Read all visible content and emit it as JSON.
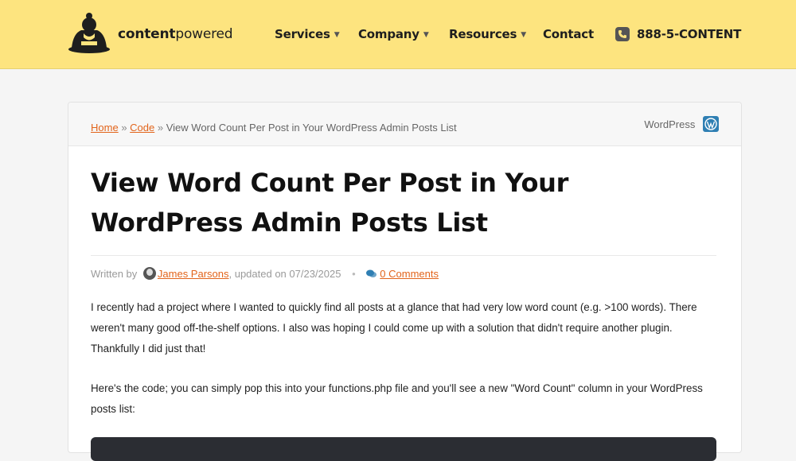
{
  "header": {
    "brand_bold": "content",
    "brand_light": "powered",
    "nav": {
      "services": "Services",
      "company": "Company",
      "resources": "Resources",
      "contact": "Contact"
    },
    "phone": "888-5-CONTENT"
  },
  "breadcrumb": {
    "home": "Home",
    "sep": "»",
    "code": "Code",
    "current": "View Word Count Per Post in Your WordPress Admin Posts List"
  },
  "category": "WordPress",
  "article": {
    "title": "View Word Count Per Post in Your WordPress Admin Posts List",
    "meta": {
      "written_by": "Written by",
      "author": "James Parsons",
      "updated": ", updated on 07/23/2025",
      "comments": "0 Comments"
    },
    "para1": "I recently had a project where I wanted to quickly find all posts at a glance that had very low word count (e.g. >100 words). There weren't many good off-the-shelf options. I also was hoping I could come up with a solution that didn't require another plugin. Thankfully I did just that!",
    "para2": "Here's the code; you can simply pop this into your functions.php file and you'll see a new \"Word Count\" column in your WordPress posts list:"
  },
  "colors": {
    "header_bg": "#fde47f",
    "link": "#e2641b",
    "wp_icon": "#2f7fb3"
  }
}
